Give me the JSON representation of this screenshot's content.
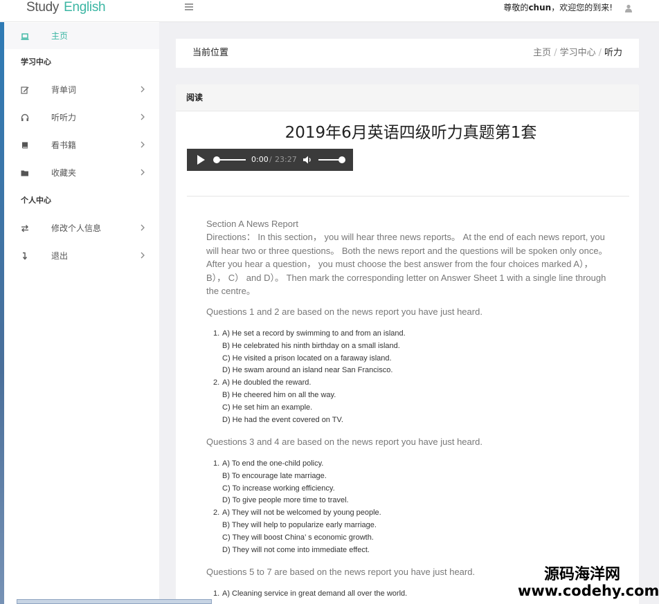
{
  "header": {
    "logo_word1": "Study",
    "logo_word2": "English",
    "welcome_prefix": "尊敬的",
    "username": "chun",
    "welcome_suffix": "，欢迎您的到来!"
  },
  "sidebar": {
    "home": "主页",
    "study_center": "学习中心",
    "study_items": [
      {
        "label": "背单词",
        "icon": "edit-icon"
      },
      {
        "label": "听听力",
        "icon": "headphones-icon"
      },
      {
        "label": "看书籍",
        "icon": "book-icon"
      },
      {
        "label": "收藏夹",
        "icon": "folder-icon"
      }
    ],
    "personal_center": "个人中心",
    "personal_items": [
      {
        "label": "修改个人信息",
        "icon": "exchange-icon"
      },
      {
        "label": "退出",
        "icon": "level-down-icon"
      }
    ]
  },
  "breadcrumb": {
    "title": "当前位置",
    "items": [
      "主页",
      "学习中心",
      "听力"
    ]
  },
  "card": {
    "header": "阅读",
    "title": "2019年6月英语四级听力真题第1套",
    "player": {
      "current_time": "0:00",
      "separator": "/",
      "duration": "23:27",
      "progress": 0,
      "volume": 1
    },
    "section_title": "Section A News Report",
    "directions": "Directions： In this section， you will hear three news reports。 At the end of each news report, you will hear two or three questions。 Both the news report and the questions will be spoken only once。 After you hear a question， you must choose the best answer from the four choices marked A），  B），  C）  and D）。 Then mark the corresponding letter on Answer Sheet 1 with a single line through the centre。",
    "groups": [
      {
        "heading": "Questions 1 and 2 are based on the news report you have just heard.",
        "questions": [
          {
            "num": "1.",
            "options": [
              "A) He set a record by swimming to and from an island.",
              "B) He celebrated his ninth birthday on a small island.",
              "C) He visited a prison located on a faraway island.",
              "D) He swam around an island near San Francisco."
            ]
          },
          {
            "num": "2.",
            "options": [
              "A) He doubled the reward.",
              "B) He cheered him on all the way.",
              "C) He set him an example.",
              "D) He had the event covered on TV."
            ]
          }
        ]
      },
      {
        "heading": "Questions 3 and 4 are based on the news report you have just heard.",
        "questions": [
          {
            "num": "1.",
            "options": [
              "A) To end the one-child policy.",
              "B) To encourage late marriage.",
              "C) To increase working efficiency.",
              "D) To give people more time to travel."
            ]
          },
          {
            "num": "2.",
            "options": [
              "A) They will not be welcomed by young people.",
              "B) They will help to popularize early marriage.",
              "C) They will boost China’ s economic growth.",
              "D) They will not come into immediate effect."
            ]
          }
        ]
      },
      {
        "heading": "Questions 5 to 7 are based on the news report you have just heard.",
        "questions": [
          {
            "num": "1.",
            "options": [
              "A) Cleaning service in great demand all over the world."
            ]
          }
        ]
      }
    ]
  },
  "watermark": {
    "line1": "源码海洋网",
    "line2": "www.codehy.com"
  }
}
